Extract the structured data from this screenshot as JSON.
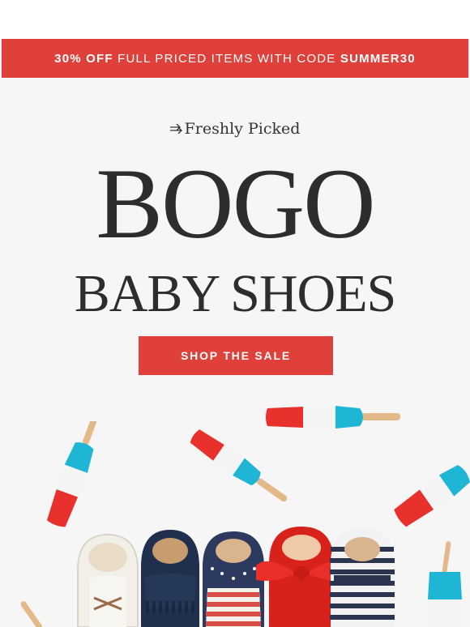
{
  "promo": {
    "discount": "30% OFF",
    "text": "FULL PRICED ITEMS WITH CODE",
    "code": "SUMMER30"
  },
  "brand": {
    "name": "Freshly Picked",
    "logo_icon": "double-arrow-icon"
  },
  "hero": {
    "headline": "BOGO",
    "subheadline": "BABY SHOES"
  },
  "cta": {
    "label": "SHOP THE SALE"
  },
  "colors": {
    "brand_red": "#e0403a",
    "popsicle_red": "#e8302c",
    "popsicle_blue": "#1fb6d6",
    "navy": "#1f2f4d",
    "text_dark": "#2d2d2d"
  },
  "images": {
    "popsicles": [
      "rocket-popsicle",
      "rocket-popsicle",
      "rocket-popsicle",
      "rocket-popsicle",
      "rocket-popsicle"
    ],
    "shoes": [
      "white-lace-moccasin",
      "navy-fringe-moccasin",
      "flag-moccasin",
      "red-bow-mary-jane",
      "striped-mary-jane"
    ]
  }
}
